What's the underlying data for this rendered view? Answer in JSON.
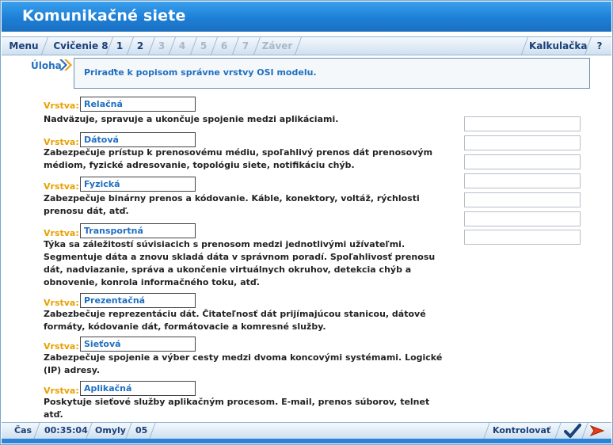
{
  "app": {
    "title": "Komunikačné siete"
  },
  "nav": {
    "menu": "Menu",
    "exercise": "Cvičenie 8",
    "pages": [
      "1",
      "2",
      "3",
      "4",
      "5",
      "6",
      "7"
    ],
    "end": "Záver",
    "calculator": "Kalkulačka",
    "help": "?"
  },
  "task": {
    "label": "Úloha",
    "text": "Priraďte k popisom správne vrstvy OSI modelu."
  },
  "rows": [
    {
      "prefix": "Vrstva:",
      "layer": "Relačná",
      "desc": "Nadväzuje, spravuje a ukončuje spojenie medzi aplikáciami."
    },
    {
      "prefix": "Vrstva:",
      "layer": "Dátová",
      "desc": "Zabezpečuje prístup k prenosovému médiu, spoľahlivý prenos dát prenosovým médiom, fyzické adresovanie, topológiu siete, notifikáciu chýb."
    },
    {
      "prefix": "Vrstva:",
      "layer": "Fyzická",
      "desc": "Zabezpečuje binárny prenos a kódovanie. Káble, konektory, voltáž, rýchlosti prenosu dát, atď."
    },
    {
      "prefix": "Vrstva:",
      "layer": "Transportná",
      "desc": "Týka sa záležitostí súvisiacich s prenosom medzi jednotlivými užívateľmi. Segmentuje dáta a znovu skladá dáta v správnom poradí. Spoľahlivosť prenosu dát, nadviazanie, správa a ukončenie virtuálnych okruhov, detekcia chýb a obnovenie, konrola informačného toku, atď."
    },
    {
      "prefix": "Vrstva:",
      "layer": "Prezentačná",
      "desc": "Zabezbečuje reprezentáciu dát. Čitateľnosť dát prijímajúcou stanicou, dátové formáty, kódovanie dát, formátovacie a komresné služby."
    },
    {
      "prefix": "Vrstva:",
      "layer": "Sieťová",
      "desc": "Zabezpečuje spojenie a výber cesty medzi dvoma koncovými systémami. Logické (IP) adresy."
    },
    {
      "prefix": "Vrstva:",
      "layer": "Aplikačná",
      "desc": "Poskytuje sieťové služby aplikačným procesom. E-mail, prenos súborov, telnet atď."
    }
  ],
  "answer_slots": 7,
  "status": {
    "time_label": "Čas",
    "time_value": "00:35:04",
    "errors_label": "Omyly",
    "errors_value": "05",
    "check_label": "Kontrolovať"
  },
  "colors": {
    "accent": "#1d7fd6",
    "label": "#e8a000",
    "text_blue": "#1f6fc0"
  }
}
